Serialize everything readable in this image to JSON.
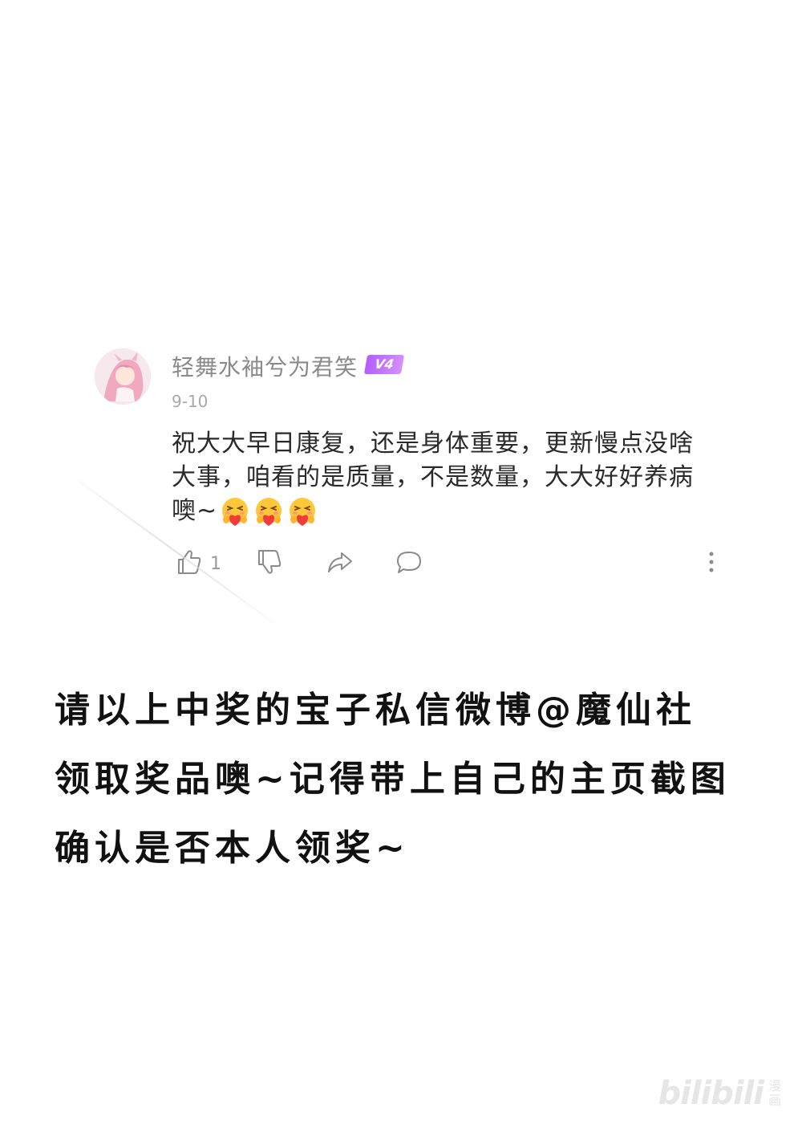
{
  "comment": {
    "username": "轻舞水袖兮为君笑",
    "badge": "V4",
    "date": "9-10",
    "text": "祝大大早日康复，还是身体重要，更新慢点没啥大事，咱看的是质量，不是数量，大大好好养病噢~",
    "emoji_name": "heart-hug-emoji",
    "emoji_count": 3,
    "likes": "1",
    "colors": {
      "badge_start": "#b35cff",
      "badge_end": "#d690ff",
      "username": "#8a8a8a",
      "body_text": "#2a2a2a",
      "icons": "#8b8b8b"
    }
  },
  "actions": {
    "like_icon": "thumbs-up-icon",
    "dislike_icon": "thumbs-down-icon",
    "share_icon": "share-arrow-icon",
    "reply_icon": "comment-bubble-icon",
    "more_icon": "more-vertical-icon"
  },
  "notice": {
    "lines": [
      "请以上中奖的宝子私信微博@魔仙社",
      "领取奖品噢~记得带上自己的主页截图",
      "确认是否本人领奖~"
    ]
  },
  "watermark": {
    "text": "bilibili",
    "sub": "漫画"
  }
}
